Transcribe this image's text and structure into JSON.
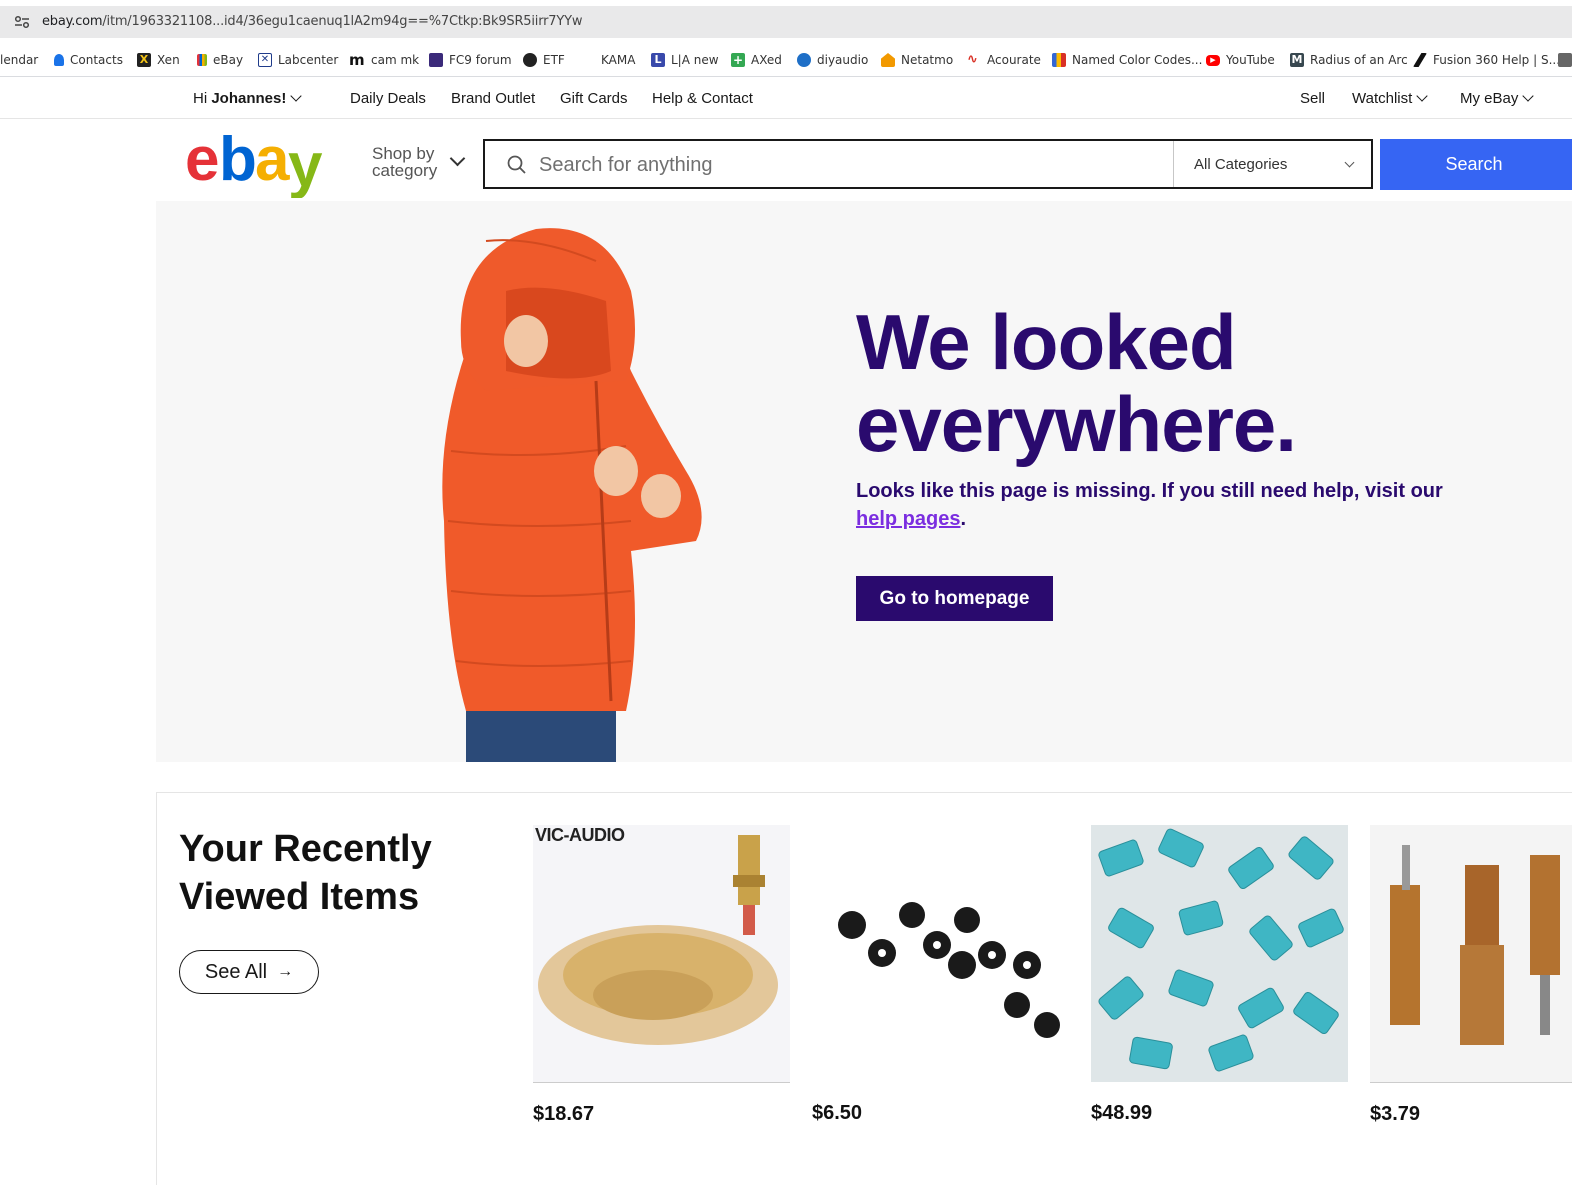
{
  "browser": {
    "url_host": "ebay.com",
    "url_path": "/itm/1963321108...id4/36egu1caenuq1lA2m94g==%7Ctkp:Bk9SR5iirr7YYw",
    "bookmarks": [
      {
        "label": "lendar",
        "color": "#1a73e8"
      },
      {
        "label": "Contacts",
        "color": "#1a73e8"
      },
      {
        "label": "Xen",
        "color": "#222222"
      },
      {
        "label": "eBay",
        "color": "#e53238"
      },
      {
        "label": "Labcenter",
        "color": "#1f3b8a"
      },
      {
        "label": "cam mk",
        "color": "#222222"
      },
      {
        "label": "FC9 forum",
        "color": "#3b2a7a"
      },
      {
        "label": "ETF",
        "color": "#222222"
      },
      {
        "label": "KAMA",
        "color": "#ffffff"
      },
      {
        "label": "L|A new",
        "color": "#3949ab"
      },
      {
        "label": "AXed",
        "color": "#34a853"
      },
      {
        "label": "diyaudio",
        "color": "#1e6fc7"
      },
      {
        "label": "Netatmo",
        "color": "#f29900"
      },
      {
        "label": "Acourate",
        "color": "#d93025"
      },
      {
        "label": "Named Color Codes...",
        "color": "#3367d6"
      },
      {
        "label": "YouTube",
        "color": "#ff0000"
      },
      {
        "label": "Radius of an Arc",
        "color": "#37474f"
      },
      {
        "label": "Fusion 360 Help | S...",
        "color": "#111111"
      }
    ]
  },
  "header": {
    "greeting_prefix": "Hi ",
    "user_name": "Johannes!",
    "nav": [
      "Daily Deals",
      "Brand Outlet",
      "Gift Cards",
      "Help & Contact"
    ],
    "sell": "Sell",
    "watchlist": "Watchlist",
    "my_ebay": "My eBay"
  },
  "search": {
    "shop_by_line1": "Shop by",
    "shop_by_line2": "category",
    "placeholder": "Search for anything",
    "category": "All Categories",
    "button": "Search"
  },
  "hero": {
    "title_line1": "We looked",
    "title_line2": "everywhere.",
    "message": "Looks like this page is missing. If you still need help, visit our ",
    "help_link": "help pages",
    "message_end": ".",
    "button": "Go to homepage",
    "colors": {
      "title": "#2a0a6e",
      "button_bg": "#2a0a6e",
      "link": "#7b2ee0"
    }
  },
  "recent": {
    "title_line1": "Your Recently",
    "title_line2": "Viewed Items",
    "see_all": "See All",
    "items": [
      {
        "price": "$18.67",
        "image_text": "VIC-AUDIO"
      },
      {
        "price": "$6.50"
      },
      {
        "price": "$48.99"
      },
      {
        "price": "$3.79"
      }
    ]
  },
  "logo_colors": {
    "e": "#e53238",
    "b": "#0064d2",
    "a": "#f5af02",
    "y": "#86b817"
  }
}
